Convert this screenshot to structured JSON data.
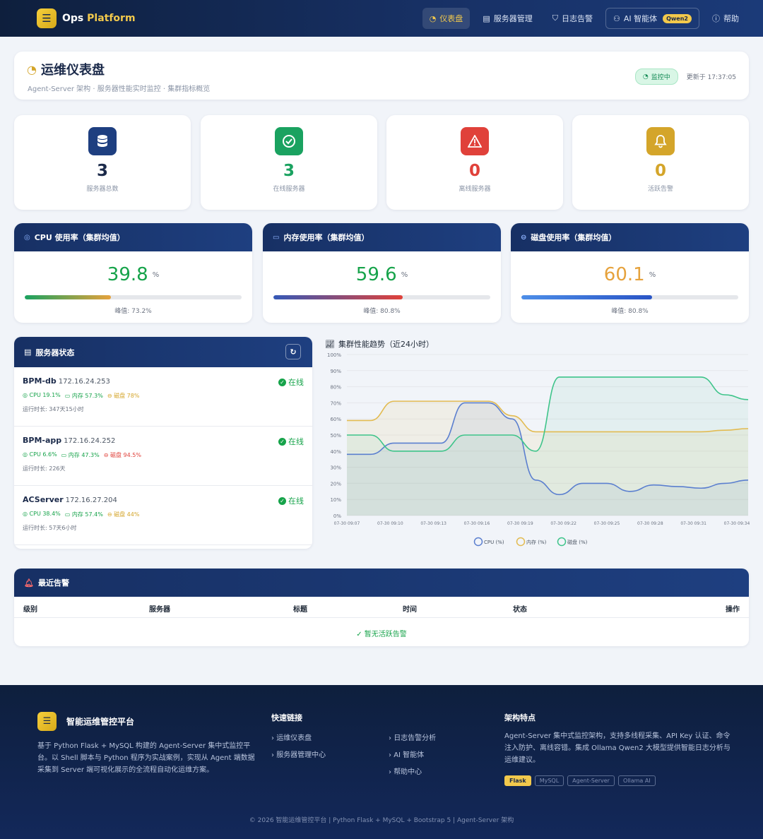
{
  "nav": {
    "brand_prefix": "Ops ",
    "brand_accent": "Platform",
    "items": [
      {
        "label": "仪表盘",
        "icon": "gauge-icon",
        "active": true
      },
      {
        "label": "服务器管理",
        "icon": "server-icon",
        "active": false
      },
      {
        "label": "日志告警",
        "icon": "shield-icon",
        "active": false
      },
      {
        "label": "AI 智能体",
        "icon": "robot-icon",
        "active": false,
        "badge": "Qwen2"
      },
      {
        "label": "帮助",
        "icon": "help-icon",
        "active": false
      }
    ]
  },
  "header": {
    "title": "运维仪表盘",
    "subtitle": "Agent-Server 架构 · 服务器性能实时监控 · 集群指标概览",
    "monitor_badge": "监控中",
    "updated": "更新于 17:37:05"
  },
  "stats": [
    {
      "value": "3",
      "label": "服务器总数",
      "icon": "database-icon",
      "color": "#1e3f80"
    },
    {
      "value": "3",
      "label": "在线服务器",
      "icon": "check-circle-icon",
      "color": "#1aa260"
    },
    {
      "value": "0",
      "label": "离线服务器",
      "icon": "warning-icon",
      "color": "#e0413a"
    },
    {
      "value": "0",
      "label": "活跃告警",
      "icon": "bell-icon",
      "color": "#d4a52a"
    }
  ],
  "usage": [
    {
      "title": "CPU 使用率（集群均值）",
      "value": "39.8",
      "unit": "%",
      "peak": "峰值: 73.2%",
      "fraction": 0.398,
      "value_color": "#16a34a",
      "icon": "cpu-icon"
    },
    {
      "title": "内存使用率（集群均值）",
      "value": "59.6",
      "unit": "%",
      "peak": "峰值: 80.8%",
      "fraction": 0.596,
      "value_color": "#16a34a",
      "icon": "memory-icon"
    },
    {
      "title": "磁盘使用率（集群均值）",
      "value": "60.1",
      "unit": "%",
      "peak": "峰值: 80.8%",
      "fraction": 0.601,
      "value_color": "#e6a23c",
      "icon": "disk-icon"
    }
  ],
  "servers_panel": {
    "title": "服务器状态",
    "servers": [
      {
        "name": "BPM-db",
        "ip": "172.16.24.253",
        "status": "在线",
        "cpu": "CPU 19.1%",
        "mem": "内存 57.3%",
        "disk": "磁盘 78%",
        "disk_hot": false,
        "uptime": "运行时长: 347天15小时"
      },
      {
        "name": "BPM-app",
        "ip": "172.16.24.252",
        "status": "在线",
        "cpu": "CPU 6.6%",
        "mem": "内存 47.3%",
        "disk": "磁盘 94.5%",
        "disk_hot": true,
        "uptime": "运行时长: 226天"
      },
      {
        "name": "ACServer",
        "ip": "172.16.27.204",
        "status": "在线",
        "cpu": "CPU 38.4%",
        "mem": "内存 57.4%",
        "disk": "磁盘 44%",
        "disk_hot": false,
        "uptime": "运行时长: 57天6小时"
      }
    ]
  },
  "chart_data": {
    "type": "area",
    "title": "集群性能趋势（近24小时）",
    "x": [
      "07-30 09:07",
      "07-30 09:10",
      "07-30 09:13",
      "07-30 09:16",
      "07-30 09:19",
      "07-30 09:22",
      "07-30 09:25",
      "07-30 09:28",
      "07-30 09:31",
      "07-30 09:34"
    ],
    "y_ticks": [
      "0%",
      "10%",
      "20%",
      "30%",
      "40%",
      "50%",
      "60%",
      "70%",
      "80%",
      "90%",
      "100%"
    ],
    "ylim": [
      0,
      100
    ],
    "grid": true,
    "legend_position": "bottom",
    "series": [
      {
        "name": "CPU (%)",
        "color": "#5b7fcf",
        "values": [
          38,
          38,
          45,
          45,
          45,
          70,
          70,
          60,
          22,
          13,
          20,
          20,
          15,
          19,
          18,
          17,
          20,
          22
        ]
      },
      {
        "name": "内存 (%)",
        "color": "#e2bb51",
        "values": [
          59,
          59,
          71,
          71,
          71,
          71,
          71,
          62,
          52,
          52,
          52,
          52,
          52,
          52,
          52,
          52,
          53,
          54
        ]
      },
      {
        "name": "磁盘 (%)",
        "color": "#3ec48a",
        "values": [
          50,
          50,
          40,
          40,
          40,
          50,
          50,
          50,
          40,
          86,
          86,
          86,
          86,
          86,
          86,
          86,
          75,
          72
        ]
      }
    ]
  },
  "alerts": {
    "title": "最近告警",
    "columns": [
      "级别",
      "服务器",
      "标题",
      "时间",
      "状态",
      "操作"
    ],
    "empty": "暂无活跃告警"
  },
  "footer": {
    "brand": "智能运维管控平台",
    "desc": "基于 Python Flask + MySQL 构建的 Agent-Server 集中式监控平台。以 Shell 脚本与 Python 程序为实战案例，实现从 Agent 端数据采集到 Server 端可视化展示的全流程自动化运维方案。",
    "quick_title": "快速链接",
    "links_left": [
      "运维仪表盘",
      "服务器管理中心"
    ],
    "links_right": [
      "日志告警分析",
      "AI 智能体",
      "帮助中心"
    ],
    "arch_title": "架构特点",
    "arch_desc": "Agent-Server 集中式监控架构，支持多线程采集、API Key 认证、命令注入防护、离线容错。集成 Ollama Qwen2 大模型提供智能日志分析与运维建议。",
    "tags": [
      "Flask",
      "MySQL",
      "Agent-Server",
      "Ollama AI"
    ],
    "copyright": "© 2026 智能运维管控平台 | Python Flask + MySQL + Bootstrap 5 | Agent-Server 架构"
  }
}
